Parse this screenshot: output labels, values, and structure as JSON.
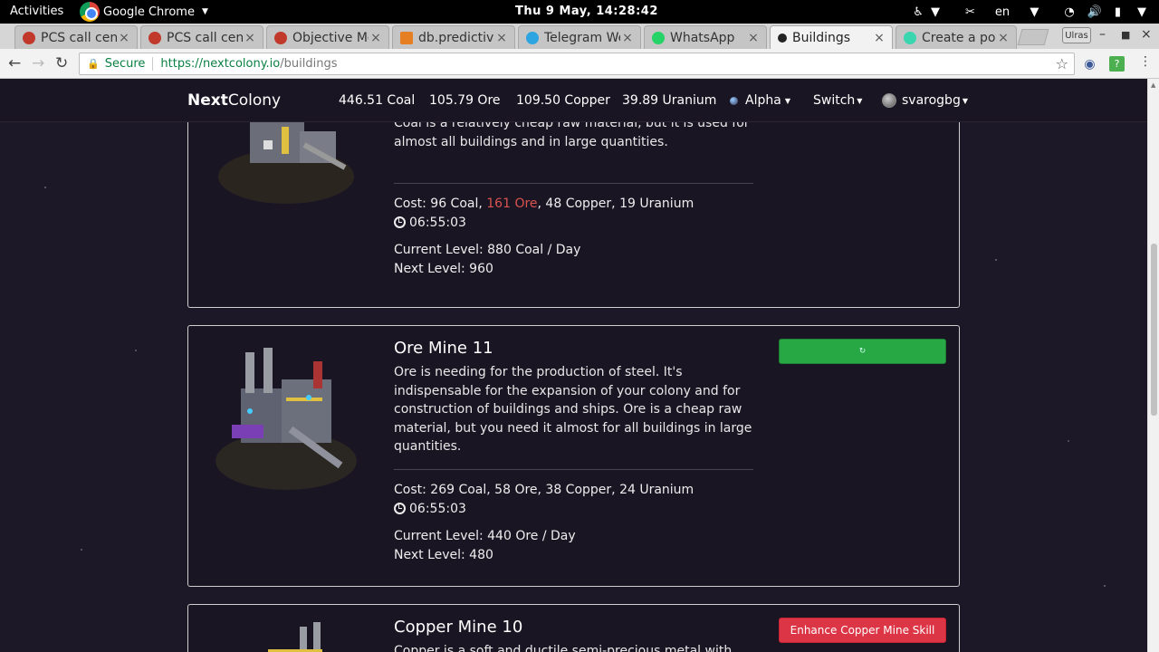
{
  "gnome": {
    "activities": "Activities",
    "app": "Google Chrome",
    "clock": "Thu  9 May, 14:28:42",
    "lang": "en"
  },
  "tabs": [
    {
      "title": "PCS call cent",
      "favicon_color": "#c0392b"
    },
    {
      "title": "PCS call cent",
      "favicon_color": "#c0392b"
    },
    {
      "title": "Objective Mo",
      "favicon_color": "#c0392b"
    },
    {
      "title": "db.predictive",
      "favicon_color": "#e67e22"
    },
    {
      "title": "Telegram We",
      "favicon_color": "#2ca5e0"
    },
    {
      "title": "WhatsApp",
      "favicon_color": "#25d366"
    },
    {
      "title": "Buildings",
      "favicon_color": "#222222"
    },
    {
      "title": "Create a pos",
      "favicon_color": "#3ad6b0"
    }
  ],
  "browser": {
    "profile": "Ulras",
    "secure_label": "Secure",
    "url_host": "https://nextcolony.io",
    "url_path": "/buildings"
  },
  "app": {
    "brand_bold": "Next",
    "brand_rest": "Colony",
    "resources": [
      "446.51 Coal",
      "105.79 Ore",
      "109.50 Copper",
      "39.89 Uranium"
    ],
    "planet": "Alpha",
    "switch_label": "Switch",
    "user": "svarogbg"
  },
  "buildings": [
    {
      "description": "Coal is a relatively cheap raw material, but it is used for almost all buildings and in large quantities.",
      "cost_prefix": "Cost: 96 Coal, ",
      "cost_short": "161 Ore",
      "cost_suffix": ", 48 Copper, 19 Uranium",
      "time": "06:55:03",
      "current_level": "Current Level: 880 Coal / Day",
      "next_level": "Next Level: 960"
    },
    {
      "title": "Ore Mine 11",
      "description": "Ore is needing for the production of steel. It's indispensable for the expansion of your colony and for construction of buildings and ships. Ore is a cheap raw material, but you need it almost for all buildings in large quantities.",
      "cost": "Cost: 269 Coal, 58 Ore, 38 Copper, 24 Uranium",
      "time": "06:55:03",
      "current_level": "Current Level: 440 Ore / Day",
      "next_level": "Next Level: 480",
      "button_color": "#28a745"
    },
    {
      "title": "Copper Mine 10",
      "description": "Copper is a soft and ductile semi-precious metal with excellent",
      "button_label": "Enhance Copper Mine Skill",
      "button_color": "#dc3545"
    }
  ]
}
